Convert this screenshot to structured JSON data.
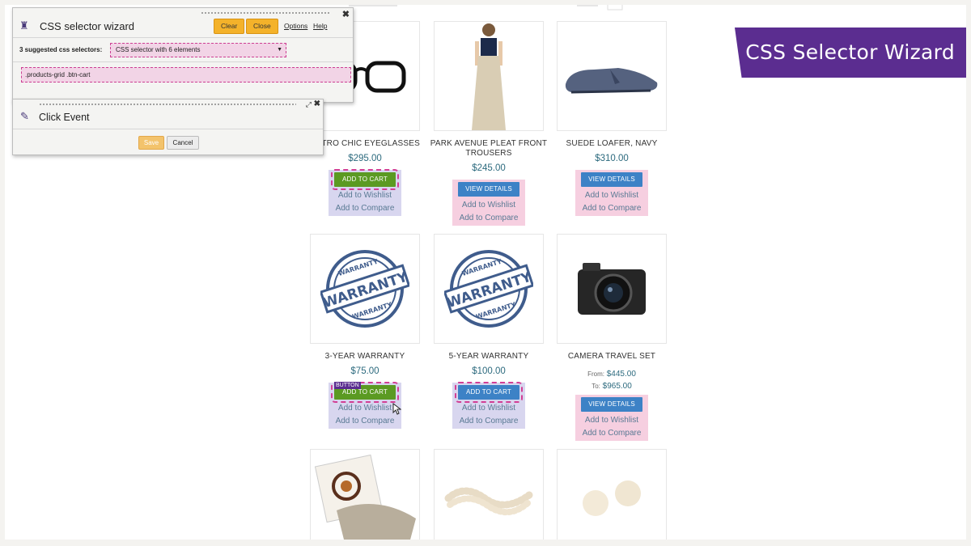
{
  "wizard": {
    "title": "CSS selector wizard",
    "clear_label": "Clear",
    "close_label": "Close",
    "options_label": "Options",
    "help_label": "Help",
    "suggested_label": "3 suggested css selectors:",
    "selected_option": "CSS selector with 6 elements",
    "selector_value": ".products-grid .btn-cart"
  },
  "click_event": {
    "title": "Click Event",
    "save_label": "Save",
    "cancel_label": "Cancel"
  },
  "banner": {
    "text": "CSS Selector Wizard"
  },
  "highlight_tag": "BUTTON",
  "products": [
    {
      "name": "RETRO CHIC EYEGLASSES",
      "price": "$295.00",
      "button": "ADD TO CART",
      "wishlist": "Add to Wishlist",
      "compare": "Add to Compare"
    },
    {
      "name": "PARK AVENUE PLEAT FRONT TROUSERS",
      "price": "$245.00",
      "button": "VIEW DETAILS",
      "wishlist": "Add to Wishlist",
      "compare": "Add to Compare"
    },
    {
      "name": "SUEDE LOAFER, NAVY",
      "price": "$310.00",
      "button": "VIEW DETAILS",
      "wishlist": "Add to Wishlist",
      "compare": "Add to Compare"
    },
    {
      "name": "3-YEAR WARRANTY",
      "price": "$75.00",
      "button": "ADD TO CART",
      "wishlist": "Add to Wishlist",
      "compare": "Add to Compare"
    },
    {
      "name": "5-YEAR WARRANTY",
      "price": "$100.00",
      "button": "ADD TO CART",
      "wishlist": "Add to Wishlist",
      "compare": "Add to Compare"
    },
    {
      "name": "CAMERA TRAVEL SET",
      "from_label": "From:",
      "from_price": "$445.00",
      "to_label": "To:",
      "to_price": "$965.00",
      "button": "VIEW DETAILS",
      "wishlist": "Add to Wishlist",
      "compare": "Add to Compare"
    }
  ],
  "warranty_stamp": {
    "top": "WARRANTY",
    "middle": "WARRANTY",
    "bottom": "WARRANTY"
  },
  "colors": {
    "accent": "#5b2d90",
    "highlight": "#d23f95",
    "wizard_button": "#f4b22a"
  }
}
